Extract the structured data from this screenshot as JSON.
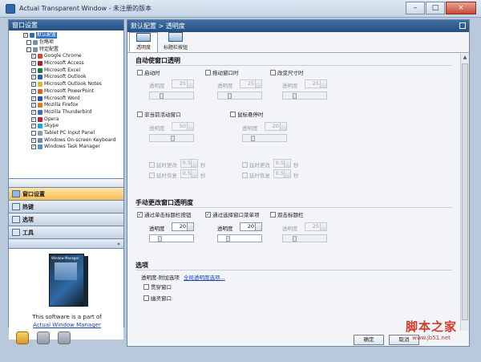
{
  "window": {
    "title": "Actual Transparent Window - 未注册的版本",
    "buttons": [
      "–",
      "□",
      "×"
    ]
  },
  "left": {
    "header": "窗口设置",
    "tree": [
      {
        "label": "默认配置",
        "checked": true,
        "selected": true,
        "color": "#2f6bb5"
      },
      {
        "label": "包略项",
        "checked": false,
        "selected": false,
        "color": "#7a8fa8"
      },
      {
        "label": "特定配置",
        "checked": false,
        "selected": false,
        "color": "#7a8fa8"
      },
      {
        "label": "Google Chrome",
        "checked": true,
        "selected": false,
        "color": "#d8452f"
      },
      {
        "label": "Microsoft Access",
        "checked": true,
        "selected": false,
        "color": "#a3242c"
      },
      {
        "label": "Microsoft Excel",
        "checked": true,
        "selected": false,
        "color": "#1f7a3b"
      },
      {
        "label": "Microsoft Outlook",
        "checked": true,
        "selected": false,
        "color": "#2b5fa8"
      },
      {
        "label": "Microsoft Outlook Notes",
        "checked": true,
        "selected": false,
        "color": "#e0b63a"
      },
      {
        "label": "Microsoft PowerPoint",
        "checked": true,
        "selected": false,
        "color": "#d2612b"
      },
      {
        "label": "Microsoft Word",
        "checked": true,
        "selected": false,
        "color": "#2a58b0"
      },
      {
        "label": "Mozilla Firefox",
        "checked": true,
        "selected": false,
        "color": "#e07a20"
      },
      {
        "label": "Mozilla Thunderbird",
        "checked": true,
        "selected": false,
        "color": "#3a6fb8"
      },
      {
        "label": "Opera",
        "checked": true,
        "selected": false,
        "color": "#c8202b"
      },
      {
        "label": "Skype",
        "checked": true,
        "selected": false,
        "color": "#1fa3e0"
      },
      {
        "label": "Tablet PC Input Panel",
        "checked": false,
        "selected": false,
        "color": "#8c9bab"
      },
      {
        "label": "Windows On-screen Keyboard",
        "checked": true,
        "selected": false,
        "color": "#6f8aa8"
      },
      {
        "label": "Windows Task Manager",
        "checked": true,
        "selected": false,
        "color": "#5c8bbf"
      }
    ],
    "nav": [
      {
        "label": "窗口设置",
        "active": true
      },
      {
        "label": "热键",
        "active": false
      },
      {
        "label": "选项",
        "active": false
      },
      {
        "label": "工具",
        "active": false
      }
    ],
    "nav_more": "»",
    "promo": {
      "text": "This software is a part of",
      "link": "Actual Window Manager",
      "box_label": "Window Manager"
    }
  },
  "right": {
    "header": "默认配置 > 透明度",
    "tabs": [
      {
        "label": "透明度",
        "active": true
      },
      {
        "label": "标题栏按钮",
        "active": false
      }
    ],
    "auto": {
      "title": "自动使窗口透明",
      "options": [
        {
          "label": "启动时",
          "checked": false
        },
        {
          "label": "拖动窗口时",
          "checked": false
        },
        {
          "label": "改变尺寸时",
          "checked": false
        }
      ],
      "opacity_label": "透明度",
      "opacity_values": [
        "25",
        "25",
        "25"
      ],
      "inactive": {
        "label": "非当前活动窗口",
        "checked": false,
        "value": "50"
      },
      "hover": {
        "label": "鼠标悬停时",
        "checked": false,
        "value": "20"
      },
      "delay_change": "延时更改",
      "delay_restore": "延时恢复",
      "delay_value": "0.5",
      "seconds": "秒"
    },
    "manual": {
      "title": "手动更改窗口透明度",
      "options": [
        {
          "label": "通过单击标题栏按钮",
          "checked": true,
          "value": "20",
          "enabled": true
        },
        {
          "label": "通过选择窗口菜单项",
          "checked": true,
          "value": "20",
          "enabled": true
        },
        {
          "label": "双击标题栏",
          "checked": false,
          "value": "25",
          "enabled": false
        }
      ],
      "opacity_label": "透明度"
    },
    "options": {
      "title": "选项",
      "extra_label": "透明度-附加选项",
      "global_link": "全局透明度选项...",
      "items": [
        {
          "label": "贯穿窗口",
          "checked": false
        },
        {
          "label": "幽灵窗口",
          "checked": false
        }
      ]
    },
    "buttons": {
      "ok": "确定",
      "cancel": "取消"
    }
  },
  "watermark": {
    "text": "脚本之家",
    "url": "www.jb51.net"
  }
}
